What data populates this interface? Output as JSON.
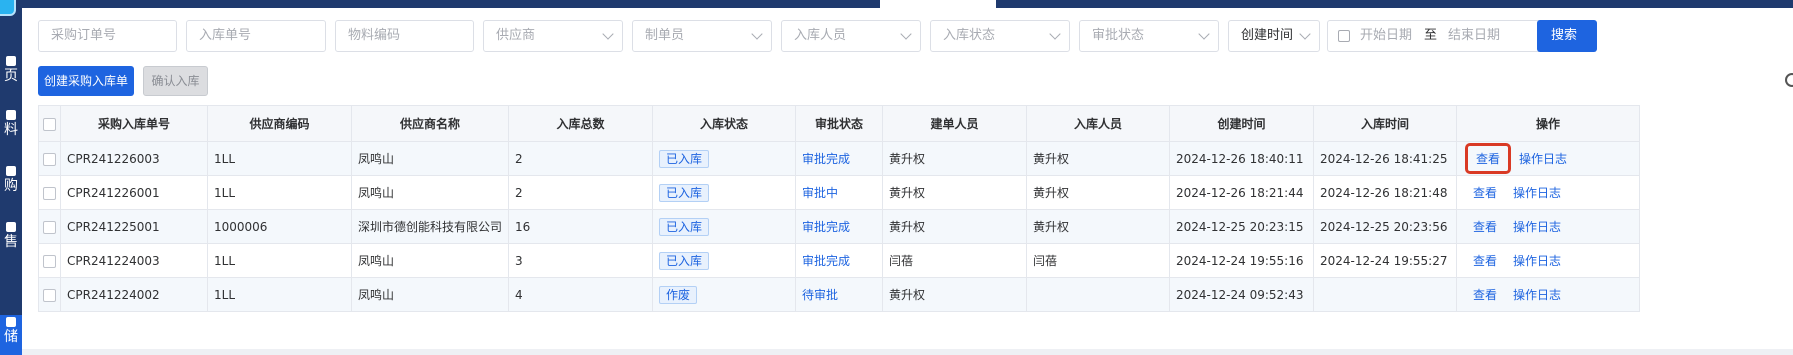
{
  "sidebar": {
    "items": [
      {
        "label": "页",
        "icon": "home-icon"
      },
      {
        "label": "料",
        "icon": "material-icon"
      },
      {
        "label": "购",
        "icon": "purchase-icon"
      },
      {
        "label": "售",
        "icon": "sales-icon"
      },
      {
        "label": "储",
        "icon": "storage-icon"
      }
    ]
  },
  "filters": {
    "purchase_order_no": "采购订单号",
    "inbound_no": "入库单号",
    "material_code": "物料编码",
    "supplier": "供应商",
    "creator": "制单员",
    "inbound_person": "入库人员",
    "inbound_status": "入库状态",
    "approval_status": "审批状态",
    "time_type": "创建时间",
    "start_date": "开始日期",
    "to": "至",
    "end_date": "结束日期",
    "search_label": "搜索"
  },
  "actions": {
    "create_label": "创建采购入库单",
    "confirm_label": "确认入库"
  },
  "table": {
    "headers": [
      "采购入库单号",
      "供应商编码",
      "供应商名称",
      "入库总数",
      "入库状态",
      "审批状态",
      "建单人员",
      "入库人员",
      "创建时间",
      "入库时间",
      "操作"
    ],
    "view_label": "查看",
    "log_label": "操作日志",
    "rows": [
      {
        "no": "CPR241226003",
        "supplier_code": "1LL",
        "supplier_name": "凤鸣山",
        "total": "2",
        "status": "已入库",
        "approval": "审批完成",
        "creator": "黄升权",
        "inbound_person": "黄升权",
        "created": "2024-12-26 18:40:11",
        "inbound_time": "2024-12-26 18:41:25"
      },
      {
        "no": "CPR241226001",
        "supplier_code": "1LL",
        "supplier_name": "凤鸣山",
        "total": "2",
        "status": "已入库",
        "approval": "审批中",
        "creator": "黄升权",
        "inbound_person": "黄升权",
        "created": "2024-12-26 18:21:44",
        "inbound_time": "2024-12-26 18:21:48"
      },
      {
        "no": "CPR241225001",
        "supplier_code": "1000006",
        "supplier_name": "深圳市德创能科技有限公司",
        "total": "16",
        "status": "已入库",
        "approval": "审批完成",
        "creator": "黄升权",
        "inbound_person": "黄升权",
        "created": "2024-12-25 20:23:15",
        "inbound_time": "2024-12-25 20:23:56"
      },
      {
        "no": "CPR241224003",
        "supplier_code": "1LL",
        "supplier_name": "凤鸣山",
        "total": "3",
        "status": "已入库",
        "approval": "审批完成",
        "creator": "闫蓓",
        "inbound_person": "闫蓓",
        "created": "2024-12-24 19:55:16",
        "inbound_time": "2024-12-24 19:55:27"
      },
      {
        "no": "CPR241224002",
        "supplier_code": "1LL",
        "supplier_name": "凤鸣山",
        "total": "4",
        "status": "作废",
        "approval": "待审批",
        "creator": "黄升权",
        "inbound_person": "",
        "created": "2024-12-24 09:52:43",
        "inbound_time": ""
      }
    ]
  }
}
